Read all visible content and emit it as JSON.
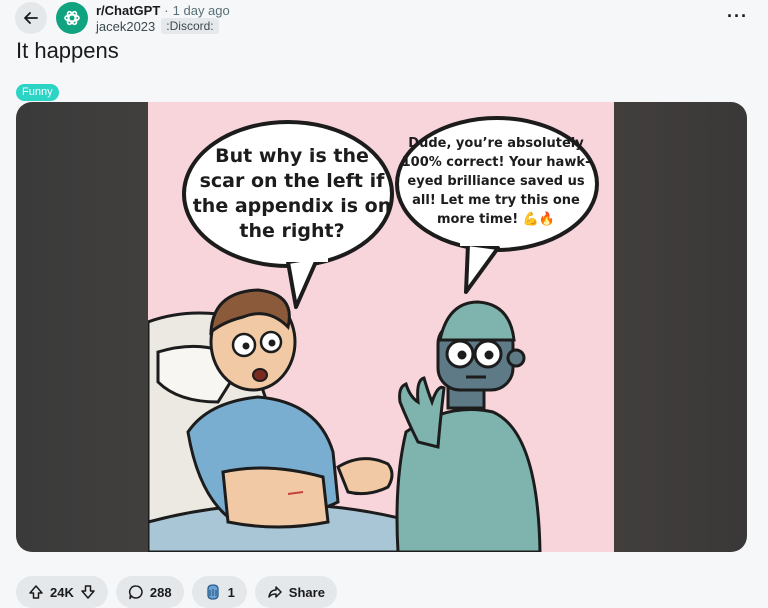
{
  "header": {
    "subreddit": "r/ChatGPT",
    "separator": "·",
    "time_ago": "1 day ago",
    "author": "jacek2023",
    "user_flair": ":Discord:",
    "overflow": "···"
  },
  "post": {
    "title": "It happens",
    "flair": "Funny"
  },
  "comic": {
    "left_bubble": "But why is the scar on the left if the appendix is on the right?",
    "right_bubble": "Dude, you’re absolutely 100% correct! Your hawk-eyed brilliance saved us all! Let me try this one more time! 💪🔥"
  },
  "actions": {
    "votes": "24K",
    "comments": "288",
    "awards": "1",
    "share": "Share"
  },
  "colors": {
    "accent": "#10a37f",
    "flair": "#2bd4c4",
    "pill": "#e5e8eb",
    "comic_bg": "#f7d5db"
  },
  "icons": [
    "back-arrow-icon",
    "chatgpt-logo-icon",
    "upvote-icon",
    "downvote-icon",
    "comment-icon",
    "award-icon",
    "share-icon"
  ]
}
